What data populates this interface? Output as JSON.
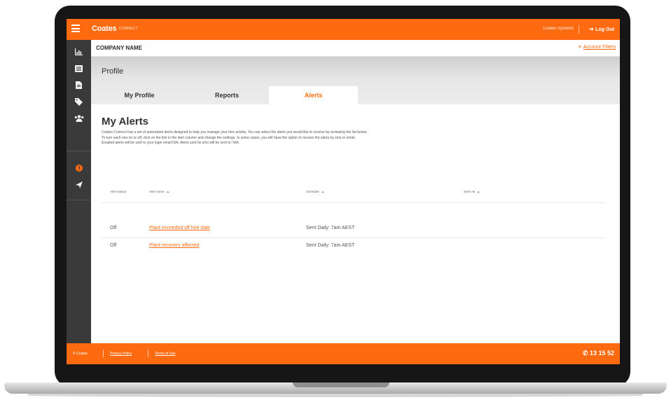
{
  "header": {
    "brand": "Coates",
    "brand_sub": "CONNECT",
    "contact_label": "Coates Systems",
    "logout_label": "Log Out"
  },
  "company_bar": {
    "company_name": "COMPANY NAME",
    "account_filters": "Account Filters"
  },
  "profile": {
    "title": "Profile",
    "tabs": [
      {
        "label": "My Profile",
        "active": false
      },
      {
        "label": "Reports",
        "active": false
      },
      {
        "label": "Alerts",
        "active": true
      }
    ]
  },
  "alerts": {
    "heading": "My Alerts",
    "description": [
      "Coates Connect has a set of automated alerts designed to help you manage your hire activity. You can select the alerts you would like to receive by reviewing the list below.",
      "To turn each one on or off, click on the link in the alert column and change the settings. In some cases, you will have the option to receive the alerts by sms or email.",
      "Emailed alerts will be sent to your login email N/A. Alerts sent by sms will be sent to: N/A."
    ],
    "columns": [
      "Alert Status",
      "Alert name",
      "Schedule",
      "Sent via"
    ],
    "rows": [
      {
        "status": "Off",
        "name": "Plant exceeded off hire date",
        "schedule": "Sent Daily: 7am AEST",
        "sent_via": ""
      },
      {
        "status": "Off",
        "name": "Plant recovery affected",
        "schedule": "Sent Daily: 7am AEST",
        "sent_via": ""
      }
    ]
  },
  "footer": {
    "copyright": "© Coates",
    "privacy": "Privacy Policy",
    "terms": "Terms of Use",
    "phone": "13 15 52"
  },
  "sidebar": {
    "icons": [
      "chart-icon",
      "list-icon",
      "document-icon",
      "tag-icon",
      "users-icon",
      "alert-icon",
      "send-icon"
    ]
  },
  "colors": {
    "accent": "#fe6a10",
    "sidebar": "#3a3a3a",
    "laptop_frame": "#161616"
  }
}
